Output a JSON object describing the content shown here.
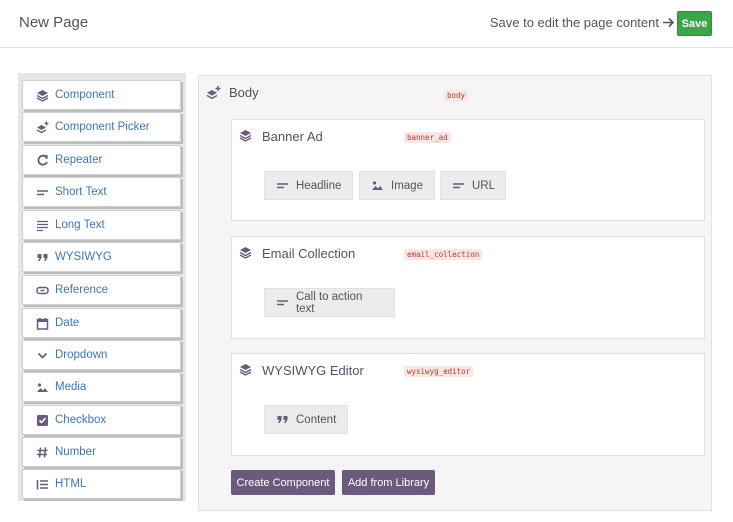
{
  "header": {
    "title": "New Page",
    "save_hint": "Save to edit the page content",
    "save_label": "Save"
  },
  "palette": {
    "items": [
      {
        "label": "Component",
        "icon": "layers-icon"
      },
      {
        "label": "Component Picker",
        "icon": "layers-plus-icon"
      },
      {
        "label": "Repeater",
        "icon": "repeat-icon"
      },
      {
        "label": "Short Text",
        "icon": "short-text-icon"
      },
      {
        "label": "Long Text",
        "icon": "long-text-icon"
      },
      {
        "label": "WYSIWYG",
        "icon": "quote-icon"
      },
      {
        "label": "Reference",
        "icon": "link-icon"
      },
      {
        "label": "Date",
        "icon": "calendar-icon"
      },
      {
        "label": "Dropdown",
        "icon": "chevron-down-icon"
      },
      {
        "label": "Media",
        "icon": "image-icon"
      },
      {
        "label": "Checkbox",
        "icon": "checkbox-icon"
      },
      {
        "label": "Number",
        "icon": "hash-icon"
      },
      {
        "label": "HTML",
        "icon": "list-icon"
      }
    ]
  },
  "body": {
    "label": "Body",
    "code": "body",
    "components": [
      {
        "title": "Banner Ad",
        "code": "banner_ad",
        "fields": [
          {
            "label": "Headline",
            "icon": "short-text-icon"
          },
          {
            "label": "Image",
            "icon": "image-icon"
          },
          {
            "label": "URL",
            "icon": "short-text-icon"
          }
        ]
      },
      {
        "title": "Email Collection",
        "code": "email_collection",
        "fields": [
          {
            "label": "Call to action text",
            "icon": "short-text-icon"
          }
        ]
      },
      {
        "title": "WYSIWYG Editor",
        "code": "wysiwyg_editor",
        "fields": [
          {
            "label": "Content",
            "icon": "quote-icon"
          }
        ]
      }
    ],
    "create_label": "Create Component",
    "library_label": "Add from Library"
  },
  "colors": {
    "accent": "#6b5a7e",
    "save": "#3aa64a",
    "link": "#3b78b5"
  }
}
